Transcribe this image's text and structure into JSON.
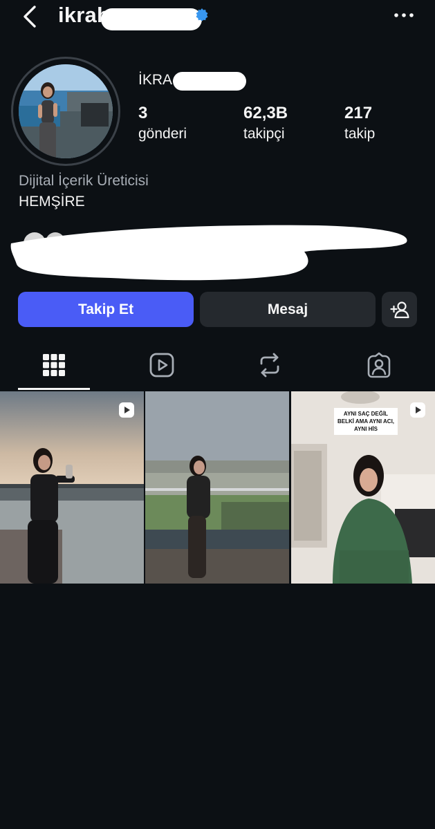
{
  "header": {
    "username": "ikrab",
    "verified": true
  },
  "profile": {
    "display_name": "İKRA",
    "stats": [
      {
        "value": "3",
        "label": "gönderi"
      },
      {
        "value": "62,3B",
        "label": "takipçi"
      },
      {
        "value": "217",
        "label": "takip"
      }
    ],
    "category": "Dijital İçerik Üreticisi",
    "bio": "HEMŞİRE"
  },
  "actions": {
    "follow_label": "Takip Et",
    "message_label": "Mesaj"
  },
  "tabs": [
    {
      "icon": "grid-icon",
      "active": true
    },
    {
      "icon": "reels-icon",
      "active": false
    },
    {
      "icon": "reposts-icon",
      "active": false
    },
    {
      "icon": "tagged-icon",
      "active": false
    }
  ],
  "posts": [
    {
      "type": "reel"
    },
    {
      "type": "image"
    },
    {
      "type": "reel",
      "caption": "AYNI SAÇ DEĞİL BELKİ AMA AYNI ACI, AYNI HİS"
    }
  ],
  "colors": {
    "background": "#0c1014",
    "follow_button": "#4a5cf6",
    "secondary_button": "#25292e",
    "muted_text": "#a8aeb6",
    "verified_badge": "#3897f0"
  }
}
